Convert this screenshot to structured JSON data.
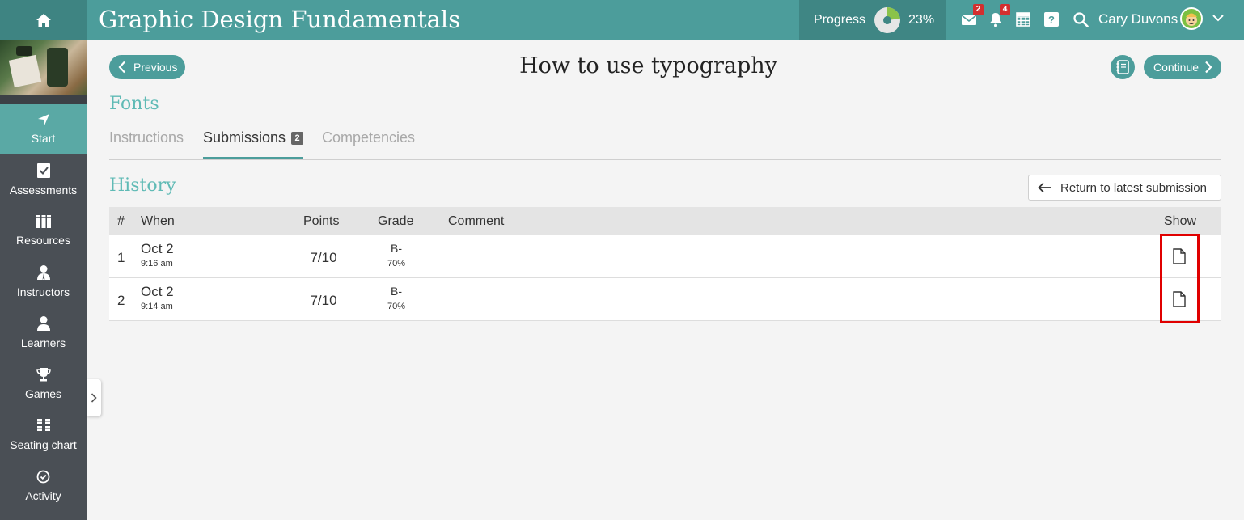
{
  "header": {
    "course_title": "Graphic Design Fundamentals",
    "progress_label": "Progress",
    "progress_value": "23%",
    "progress_fraction": 0.23,
    "messages_badge": "2",
    "notifications_badge": "4",
    "user_name": "Cary Duvons"
  },
  "sidebar": {
    "items": [
      {
        "label": "Start",
        "icon": "navigate-arrow-icon"
      },
      {
        "label": "Assessments",
        "icon": "checklist-icon"
      },
      {
        "label": "Resources",
        "icon": "books-icon"
      },
      {
        "label": "Instructors",
        "icon": "instructor-icon"
      },
      {
        "label": "Learners",
        "icon": "user-icon"
      },
      {
        "label": "Games",
        "icon": "trophy-icon"
      },
      {
        "label": "Seating chart",
        "icon": "seating-icon"
      },
      {
        "label": "Activity",
        "icon": "clock-icon"
      }
    ]
  },
  "lesson": {
    "previous_label": "Previous",
    "continue_label": "Continue",
    "title": "How to use typography",
    "section": "Fonts"
  },
  "tabs": {
    "instructions": "Instructions",
    "submissions": "Submissions",
    "submissions_count": "2",
    "competencies": "Competencies"
  },
  "history": {
    "title": "History",
    "return_label": "Return to latest submission",
    "columns": {
      "num": "#",
      "when": "When",
      "points": "Points",
      "grade": "Grade",
      "comment": "Comment",
      "show": "Show"
    },
    "rows": [
      {
        "num": "1",
        "date": "Oct 2",
        "time": "9:16 am",
        "points": "7/10",
        "grade": "B-",
        "percent": "70%",
        "comment": ""
      },
      {
        "num": "2",
        "date": "Oct 2",
        "time": "9:14 am",
        "points": "7/10",
        "grade": "B-",
        "percent": "70%",
        "comment": ""
      }
    ]
  },
  "colors": {
    "brand": "#4c9d9b",
    "accent_text": "#5fbab5",
    "sidebar": "#4a4f55",
    "highlight": "#e00000"
  }
}
